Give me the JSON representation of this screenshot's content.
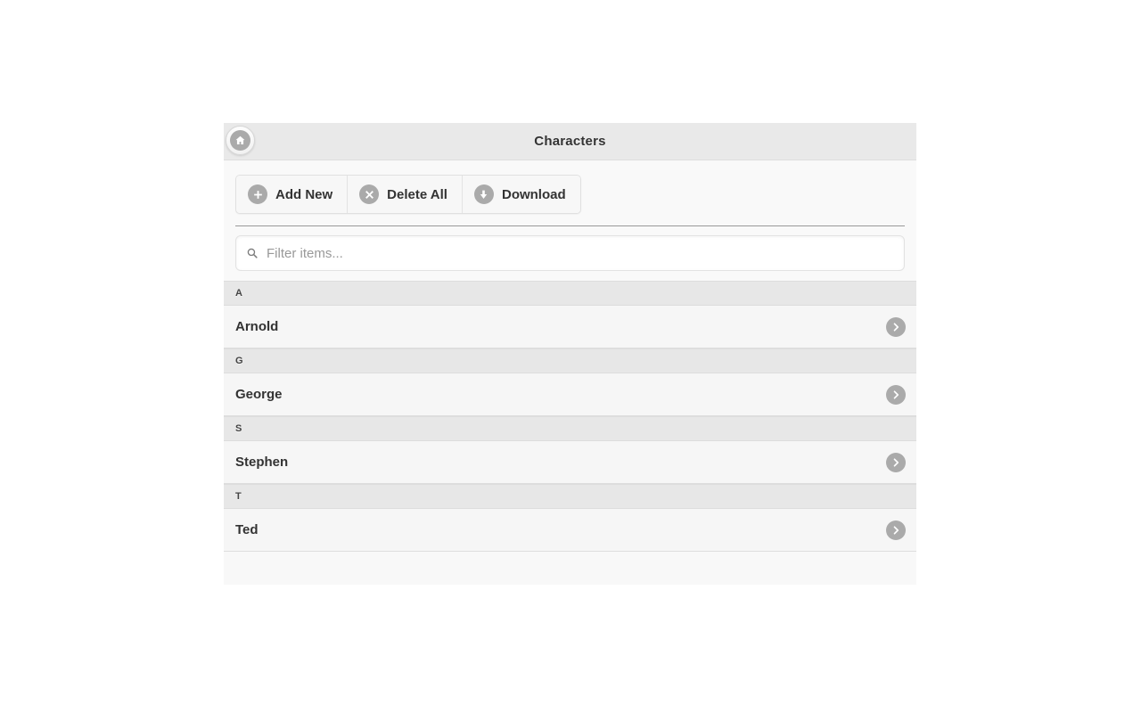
{
  "header": {
    "title": "Characters",
    "home_icon": "home-icon"
  },
  "toolbar": {
    "buttons": [
      {
        "label": "Add New",
        "icon": "plus-circle-icon"
      },
      {
        "label": "Delete All",
        "icon": "x-circle-icon"
      },
      {
        "label": "Download",
        "icon": "arrow-down-circle-icon"
      }
    ]
  },
  "filter": {
    "placeholder": "Filter items...",
    "value": "",
    "icon": "search-icon"
  },
  "list": {
    "sections": [
      {
        "letter": "A",
        "items": [
          {
            "name": "Arnold",
            "chevron": "chevron-right-icon"
          }
        ]
      },
      {
        "letter": "G",
        "items": [
          {
            "name": "George",
            "chevron": "chevron-right-icon"
          }
        ]
      },
      {
        "letter": "S",
        "items": [
          {
            "name": "Stephen",
            "chevron": "chevron-right-icon"
          }
        ]
      },
      {
        "letter": "T",
        "items": [
          {
            "name": "Ted",
            "chevron": "chevron-right-icon"
          }
        ]
      }
    ]
  },
  "colors": {
    "header_bg": "#e9e9e9",
    "body_bg": "#f9f9f9",
    "divider_bg": "#e7e7e7",
    "item_bg": "#f6f6f6",
    "icon_disc": "#aaaaaa",
    "text": "#333333"
  }
}
